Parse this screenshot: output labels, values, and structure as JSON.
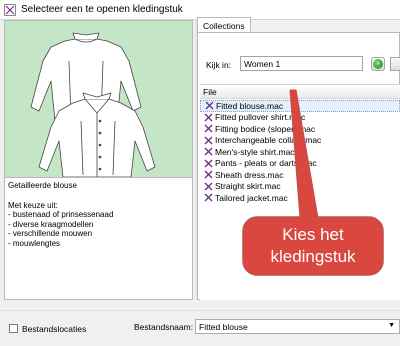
{
  "window": {
    "title": "Selecteer een te openen kledingstuk"
  },
  "preview": {
    "description_title": "Getailleerde blouse",
    "description_lines": [
      "Met keuze uit:",
      "- bustenaad of prinsessenaad",
      "- diverse kraagmodellen",
      "- verschillende mouwen",
      "- mouwlengtes"
    ]
  },
  "tabs": [
    {
      "label": "Collections"
    }
  ],
  "location": {
    "label": "Kijk in:",
    "value": "Women 1"
  },
  "file_list": {
    "column_header": "File",
    "files": [
      "Fitted blouse.mac",
      "Fitted pullover shirt.mac",
      "Fitting bodice (sloper).mac",
      "Interchangeable collars.mac",
      "Men's-style shirt.mac",
      "Pants - pleats or darts.mac",
      "Sheath dress.mac",
      "Straight skirt.mac",
      "Tailored jacket.mac"
    ],
    "selected_index": 0
  },
  "callout": {
    "line1": "Kies het",
    "line2": "kledingstuk"
  },
  "bottom": {
    "checkbox_label": "Bestandslocaties",
    "filename_label": "Bestandsnaam:",
    "filename_value": "Fitted blouse"
  },
  "colors": {
    "preview_bg": "#c5e6c6",
    "callout_fill": "#d9473f",
    "callout_border": "#c0504d",
    "selection": "#e5f0fb"
  }
}
